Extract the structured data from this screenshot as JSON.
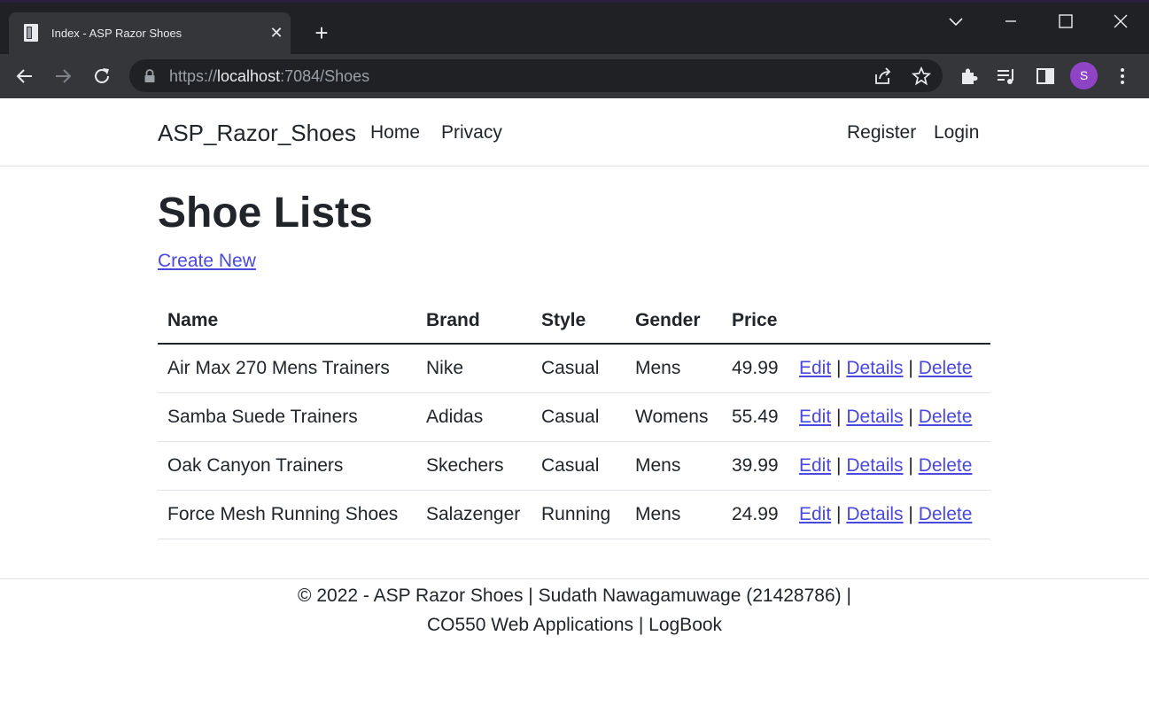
{
  "browser": {
    "tab_title": "Index - ASP Razor Shoes",
    "url_scheme": "https://",
    "url_host": "localhost",
    "url_rest": ":7084/Shoes",
    "profile_initial": "S",
    "colors": {
      "frame": "#202124",
      "toolbar": "#35363a",
      "avatar": "#8e44c4"
    }
  },
  "navbar": {
    "brand": "ASP_Razor_Shoes",
    "links": [
      "Home",
      "Privacy"
    ],
    "auth_links": [
      "Register",
      "Login"
    ]
  },
  "main": {
    "title": "Shoe Lists",
    "create_link": "Create New",
    "columns": [
      "Name",
      "Brand",
      "Style",
      "Gender",
      "Price"
    ],
    "action_labels": {
      "edit": "Edit",
      "details": "Details",
      "delete": "Delete",
      "separator": "|"
    },
    "rows": [
      {
        "name": "Air Max 270 Mens Trainers",
        "brand": "Nike",
        "style": "Casual",
        "gender": "Mens",
        "price": "49.99"
      },
      {
        "name": "Samba Suede Trainers",
        "brand": "Adidas",
        "style": "Casual",
        "gender": "Womens",
        "price": "55.49"
      },
      {
        "name": "Oak Canyon Trainers",
        "brand": "Skechers",
        "style": "Casual",
        "gender": "Mens",
        "price": "39.99"
      },
      {
        "name": "Force Mesh Running Shoes",
        "brand": "Salazenger",
        "style": "Running",
        "gender": "Mens",
        "price": "24.99"
      }
    ]
  },
  "footer": {
    "line1": "© 2022 - ASP Razor Shoes | Sudath Nawagamuwage (21428786) |",
    "line2": "CO550 Web Applications | LogBook"
  },
  "colors": {
    "link": "#4b48e0",
    "text": "#212529",
    "border": "#dee2e6"
  }
}
